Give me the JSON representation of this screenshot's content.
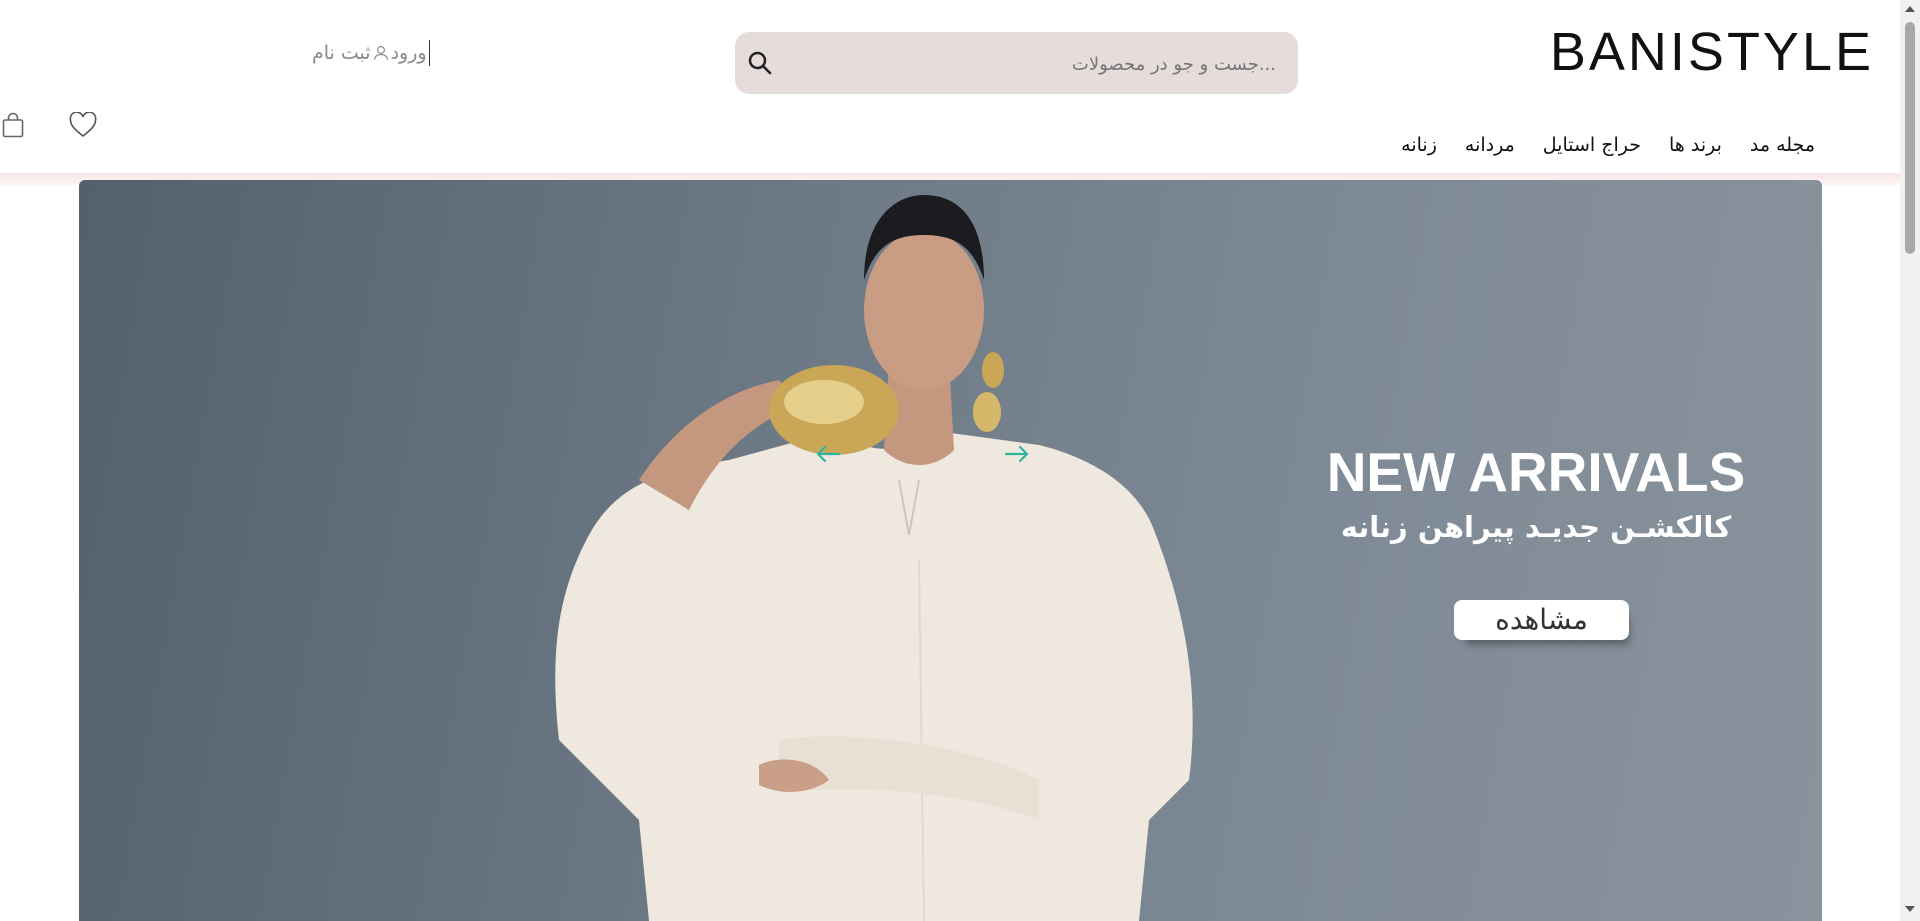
{
  "brand": {
    "logo_text": "BANISTYLE"
  },
  "search": {
    "placeholder": "...جست و جو در محصولات",
    "icon": "search-icon"
  },
  "auth": {
    "login_label": "ورود",
    "register_label": "ثبت نام",
    "icon": "user-icon"
  },
  "actions": {
    "cart_icon": "shopping-bag-icon",
    "wishlist_icon": "heart-icon"
  },
  "nav": {
    "items": [
      {
        "label": "مجله مد"
      },
      {
        "label": "برند ها"
      },
      {
        "label": "حراج استایل"
      },
      {
        "label": "مردانه"
      },
      {
        "label": "زنانه"
      }
    ]
  },
  "hero": {
    "title": "NEW ARRIVALS",
    "subtitle": "کالکشـن جدیـد پیراهن زنانه",
    "button_label": "مشاهده",
    "prev_icon": "arrow-left-icon",
    "next_icon": "arrow-right-icon"
  },
  "colors": {
    "search_bg": "#e6dcdc",
    "hero_bg": "#707d89",
    "arrow_accent": "#2fb4a0",
    "divider": "#f7e6e7"
  }
}
